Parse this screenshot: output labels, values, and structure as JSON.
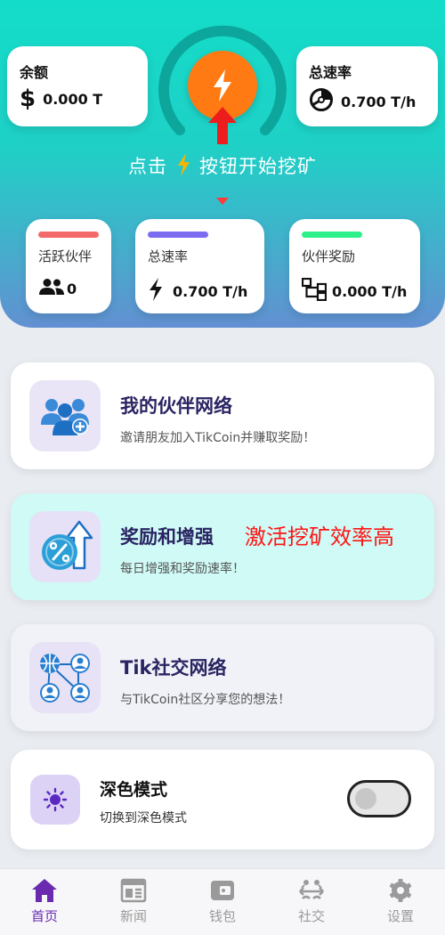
{
  "balance": {
    "title": "余额",
    "value": "0.000 T",
    "icon": "dollar-icon",
    "symbol": "$"
  },
  "total_rate_card": {
    "title": "总速率",
    "value": "0.700 T/h",
    "icon": "speed-gauge-icon"
  },
  "mine_button": {
    "icon": "lightning-bolt-icon"
  },
  "hint": {
    "before": "点击",
    "after": "按钮开始挖矿"
  },
  "stats": [
    {
      "label": "活跃伙伴",
      "value": "0",
      "icon": "group-icon",
      "bar_color": "#f46a6a"
    },
    {
      "label": "总速率",
      "value": "0.700 T/h",
      "icon": "bolt-icon",
      "bar_color": "#7b6cf0"
    },
    {
      "label": "伙伴奖励",
      "value": "0.000 T/h",
      "icon": "network-tree-icon",
      "bar_color": "#2ef08a"
    }
  ],
  "features": [
    {
      "title": "我的伙伴网络",
      "subtitle": "邀请朋友加入TikCoin并赚取奖励！",
      "icon": "add-partner-icon"
    },
    {
      "title": "奖励和增强",
      "subtitle": "每日增强和奖励速率！",
      "promo": "激活挖矿效率高",
      "icon": "percent-boost-icon"
    },
    {
      "title": "Tik社交网络",
      "subtitle": "与TikCoin社区分享您的想法！",
      "icon": "social-network-icon"
    }
  ],
  "dark_mode": {
    "title": "深色模式",
    "subtitle": "切换到深色模式",
    "enabled": false,
    "icon": "sun-icon"
  },
  "nav": [
    {
      "label": "首页",
      "icon": "home-icon",
      "active": true
    },
    {
      "label": "新闻",
      "icon": "news-icon",
      "active": false
    },
    {
      "label": "钱包",
      "icon": "wallet-icon",
      "active": false
    },
    {
      "label": "社交",
      "icon": "social-icon",
      "active": false
    },
    {
      "label": "设置",
      "icon": "settings-icon",
      "active": false
    }
  ],
  "colors": {
    "accent": "#ff7a13",
    "nav_active": "#6a2bb0",
    "promo": "#ff1414",
    "header_top": "#13ddc9",
    "header_bottom": "#6290d2"
  }
}
